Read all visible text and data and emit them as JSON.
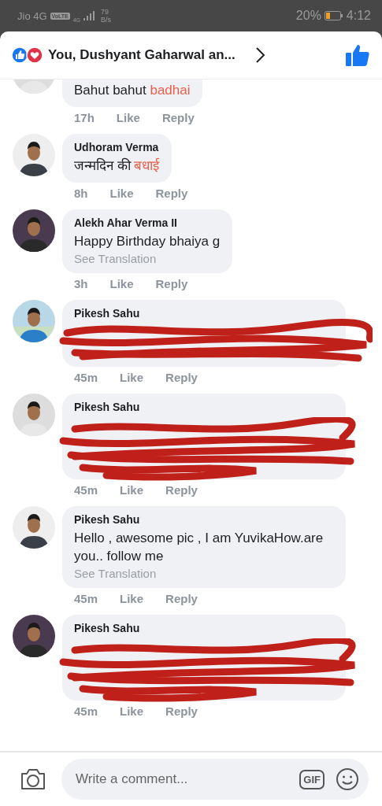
{
  "status_bar": {
    "carrier": "Jio 4G",
    "volte": "VoLTE",
    "network": "4G",
    "speed_value": "79",
    "speed_unit": "B/s",
    "battery": "20%",
    "time": "4:12"
  },
  "header": {
    "title": "You, Dushyant Gaharwal an..."
  },
  "comments": [
    {
      "cut": true,
      "kind": "text",
      "text": [
        {
          "t": "Bahut bahut ",
          "highlight": false
        },
        {
          "t": "badhai",
          "highlight": true
        }
      ],
      "time": "17h",
      "like": "Like",
      "reply": "Reply"
    },
    {
      "cut": false,
      "kind": "text",
      "name": "Udhoram Verma",
      "text": [
        {
          "t": "जन्मदिन की ",
          "highlight": false
        },
        {
          "t": "बधाई",
          "highlight": true
        }
      ],
      "time": "8h",
      "like": "Like",
      "reply": "Reply"
    },
    {
      "cut": false,
      "kind": "text",
      "name": "Alekh Ahar Verma II",
      "text": [
        {
          "t": "Happy Birthday bhaiya g",
          "highlight": false
        }
      ],
      "translation": "See Translation",
      "time": "3h",
      "like": "Like",
      "reply": "Reply"
    },
    {
      "cut": false,
      "kind": "scribble",
      "name": "Pikesh Sahu",
      "time": "45m",
      "like": "Like",
      "reply": "Reply"
    },
    {
      "cut": false,
      "kind": "bigscribble",
      "name": "Pikesh Sahu",
      "time": "45m",
      "like": "Like",
      "reply": "Reply"
    },
    {
      "cut": false,
      "kind": "text",
      "name": "Pikesh Sahu",
      "text": [
        {
          "t": "Hello , awesome pic , I am YuvikaHow.are you.. follow me",
          "highlight": false
        }
      ],
      "translation": "See Translation",
      "time": "45m",
      "like": "Like",
      "reply": "Reply"
    },
    {
      "cut": false,
      "kind": "bigscribble",
      "name": "Pikesh Sahu",
      "time": "45m",
      "like": "Like",
      "reply": "Reply"
    }
  ],
  "composer": {
    "placeholder": "Write a comment...",
    "gif": "GIF"
  }
}
